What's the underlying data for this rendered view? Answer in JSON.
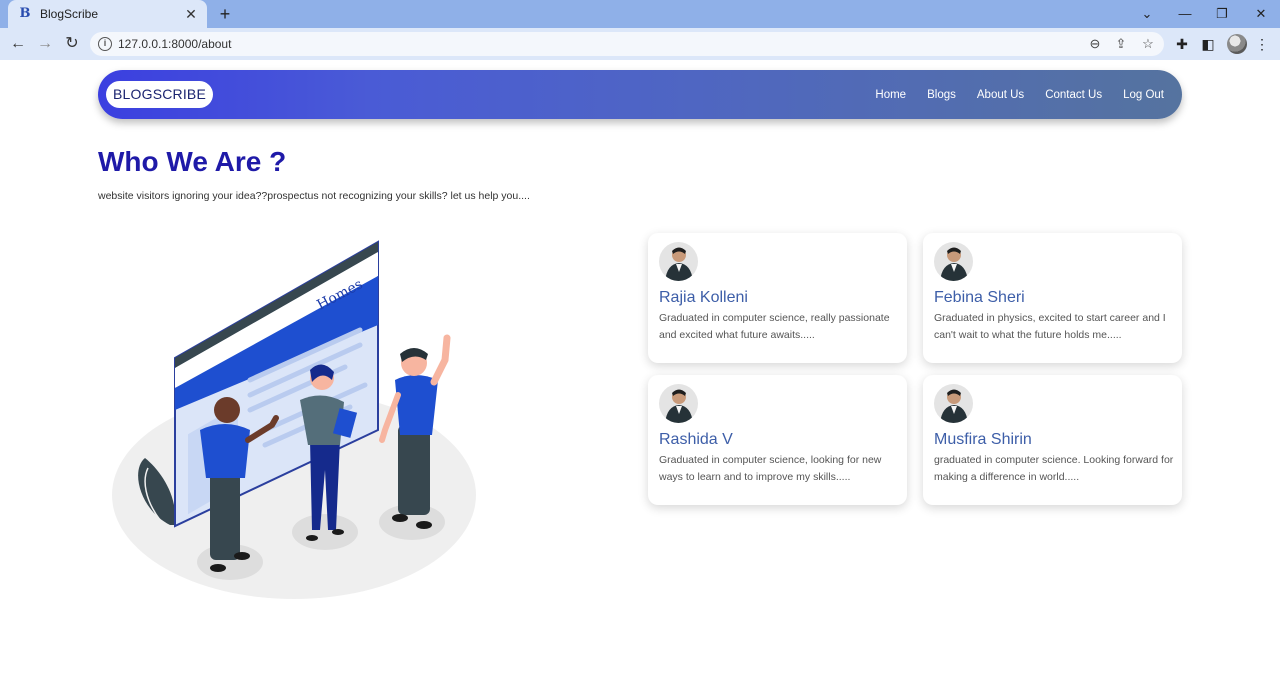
{
  "browser": {
    "tab_title": "BlogScribe",
    "tab_favicon": "B",
    "url": "127.0.0.1:8000/about"
  },
  "nav": {
    "brand": "BLOGSCRIBE",
    "links": [
      "Home",
      "Blogs",
      "About Us",
      "Contact Us",
      "Log Out"
    ]
  },
  "hero": {
    "title": "Who We Are ?",
    "subtitle": "website visitors ignoring your idea??prospectus not recognizing your skills? let us help you...."
  },
  "team": [
    {
      "name": "Rajia Kolleni",
      "description": "Graduated in computer science, really passionate and excited what future awaits....."
    },
    {
      "name": "Febina Sheri",
      "description": "Graduated in physics, excited to start career and I can't wait to what the future holds me....."
    },
    {
      "name": "Rashida V",
      "description": "Graduated in computer science, looking for new ways to learn and to improve my skills....."
    },
    {
      "name": "Musfira Shirin",
      "description": "graduated in computer science. Looking forward for making a difference in world....."
    }
  ],
  "colors": {
    "title": "#1f1aa8",
    "card_name": "#3d5ea8",
    "navbar_start": "#3b3fe0",
    "navbar_end": "#55739f"
  }
}
